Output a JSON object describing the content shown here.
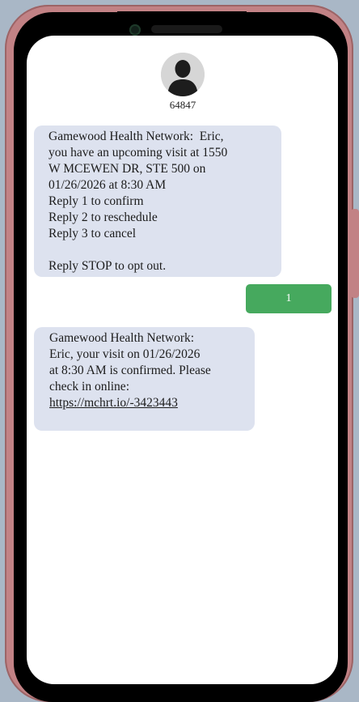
{
  "contact": {
    "number": "64847",
    "avatar_icon": "person-silhouette-icon"
  },
  "messages": [
    {
      "direction": "incoming",
      "lines": [
        "Gamewood Health Network:  Eric,",
        "you have an upcoming visit at 1550",
        "W MCEWEN DR, STE 500 on",
        "01/26/2026 at 8:30 AM",
        "Reply 1 to confirm",
        "Reply 2 to reschedule",
        "Reply 3 to cancel",
        "",
        "Reply STOP to opt out."
      ]
    },
    {
      "direction": "outgoing",
      "text": "1"
    },
    {
      "direction": "incoming",
      "lines": [
        "Gamewood Health Network:",
        "Eric, your visit on 01/26/2026",
        "at 8:30 AM is confirmed. Please",
        "check in online:"
      ],
      "link": "https://mchrt.io/-3423443"
    }
  ],
  "colors": {
    "incoming_bubble": "#dde2ef",
    "outgoing_bubble": "#46a95e",
    "phone_frame": "#c28285"
  }
}
